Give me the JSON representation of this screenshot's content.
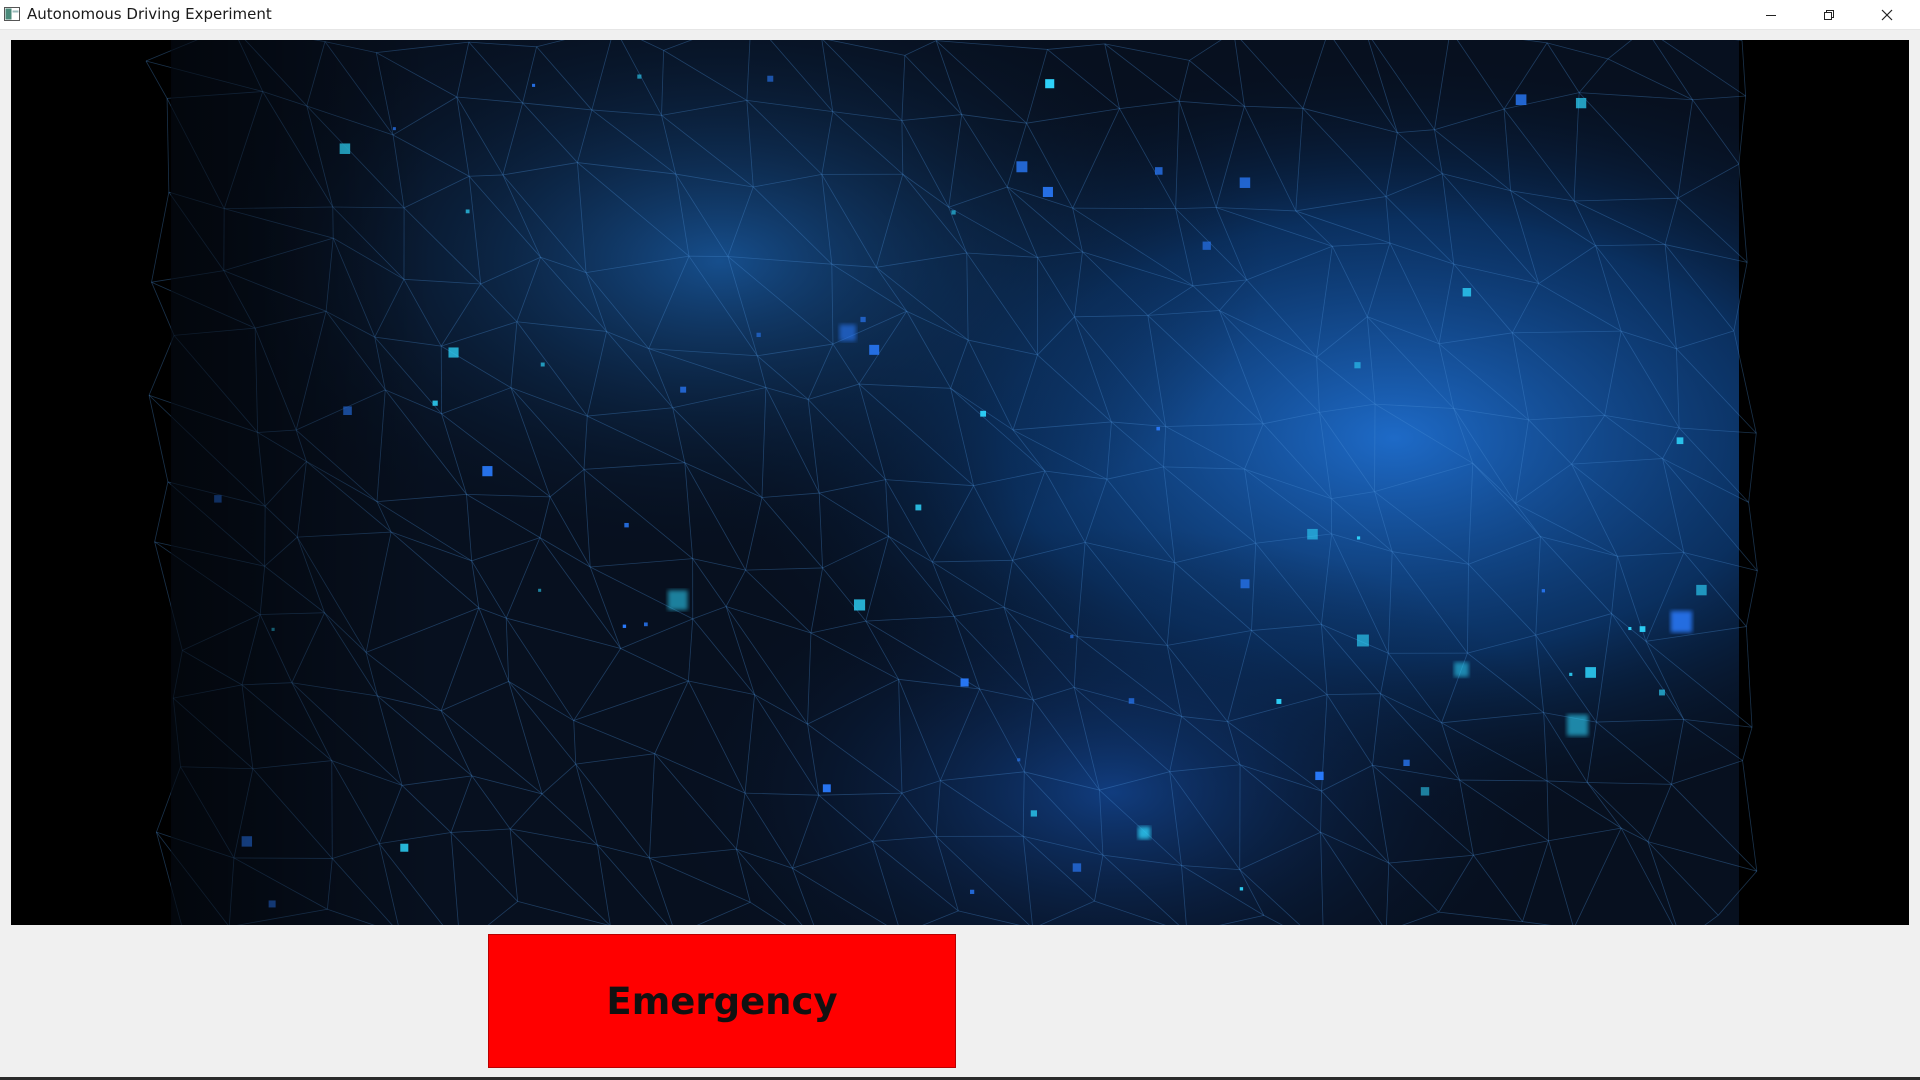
{
  "window": {
    "title": "Autonomous Driving Experiment",
    "icon": "app-window-icon",
    "controls": [
      "minimize-icon",
      "restore-icon",
      "close-icon"
    ]
  },
  "video": {
    "content": "abstract-blue-network-background"
  },
  "controls": {
    "emergency_label": "Emergency",
    "emergency_color": "#ff0000"
  }
}
